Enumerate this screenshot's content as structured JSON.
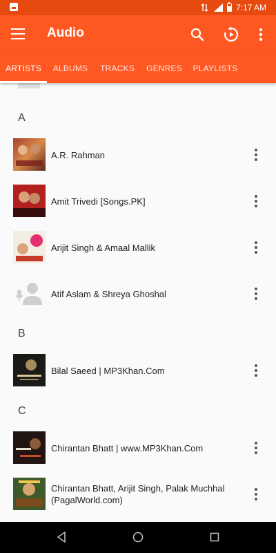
{
  "status_bar": {
    "time": "7:17 AM"
  },
  "app_bar": {
    "title": "Audio",
    "icons": [
      "menu-icon",
      "search-icon",
      "resume-playback-icon",
      "more-vert-icon"
    ]
  },
  "tabs": [
    {
      "label": "ARTISTS",
      "active": true
    },
    {
      "label": "ALBUMS",
      "active": false
    },
    {
      "label": "TRACKS",
      "active": false
    },
    {
      "label": "GENRES",
      "active": false
    },
    {
      "label": "PLAYLISTS",
      "active": false
    }
  ],
  "sections": [
    {
      "letter": "A",
      "items": [
        {
          "name": "A.R. Rahman"
        },
        {
          "name": "Amit Trivedi [Songs.PK]"
        },
        {
          "name": "Arijit Singh & Amaal Mallik"
        },
        {
          "name": "Atif Aslam & Shreya Ghoshal"
        }
      ]
    },
    {
      "letter": "B",
      "items": [
        {
          "name": "Bilal Saeed | MP3Khan.Com"
        }
      ]
    },
    {
      "letter": "C",
      "items": [
        {
          "name": "Chirantan Bhatt | www.MP3Khan.Com"
        },
        {
          "name": "Chirantan Bhatt, Arijit Singh, Palak Muchhal (PagalWorld.com)"
        }
      ]
    }
  ],
  "colors": {
    "accent": "#ff5722",
    "status": "#e64a0f"
  }
}
